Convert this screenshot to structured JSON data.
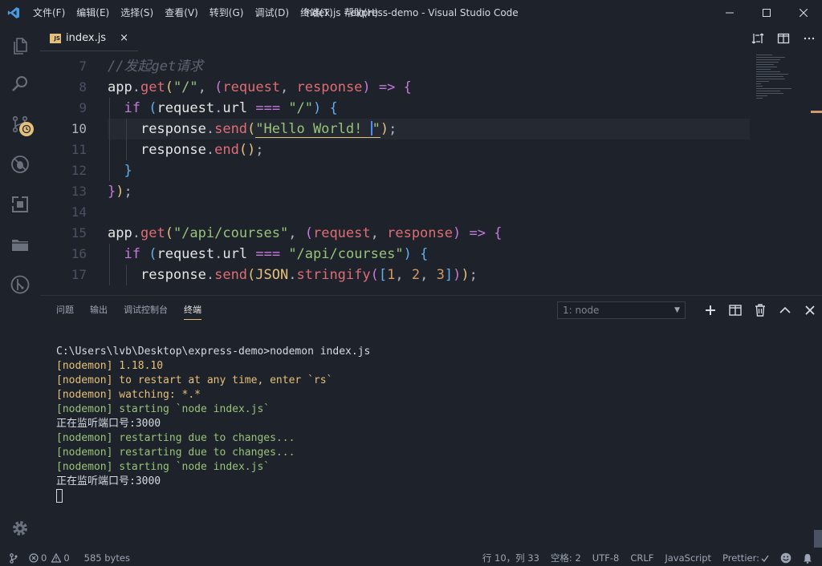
{
  "window": {
    "title": "index.js - express-demo - Visual Studio Code",
    "menu": [
      "文件(F)",
      "编辑(E)",
      "选择(S)",
      "查看(V)",
      "转到(G)",
      "调试(D)",
      "终端(T)",
      "帮助(H)"
    ]
  },
  "tab": {
    "icon_text": "JS",
    "label": "index.js",
    "close": "×"
  },
  "editor": {
    "line_numbers": [
      "7",
      "8",
      "9",
      "10",
      "11",
      "12",
      "13",
      "14",
      "15",
      "16",
      "17"
    ],
    "current_line": "10"
  },
  "panel": {
    "tabs": [
      "问题",
      "输出",
      "调试控制台",
      "终端"
    ],
    "active_tab": "终端",
    "terminal_select": "1: node",
    "terminal_lines": [
      {
        "text": "C:\\Users\\lvb\\Desktop\\express-demo>nodemon index.js",
        "color": "white"
      },
      {
        "text": "[nodemon] 1.18.10",
        "color": "yellow"
      },
      {
        "text": "[nodemon] to restart at any time, enter `rs`",
        "color": "yellow"
      },
      {
        "text": "[nodemon] watching: *.*",
        "color": "yellow"
      },
      {
        "text": "[nodemon] starting `node index.js`",
        "color": "green"
      },
      {
        "text": "正在监听端口号:3000",
        "color": "white"
      },
      {
        "text": "[nodemon] restarting due to changes...",
        "color": "green"
      },
      {
        "text": "[nodemon] restarting due to changes...",
        "color": "green"
      },
      {
        "text": "[nodemon] starting `node index.js`",
        "color": "green"
      },
      {
        "text": "正在监听端口号:3000",
        "color": "white"
      }
    ]
  },
  "statusbar": {
    "errors": "0",
    "warnings": "0",
    "file_size": "585 bytes",
    "position": "行 10，列 33",
    "spaces": "空格: 2",
    "encoding": "UTF-8",
    "eol": "CRLF",
    "language": "JavaScript",
    "prettier": "Prettier:"
  },
  "colors": {
    "background": "#1e222a",
    "accent": "#e5c07b",
    "string": "#98c379",
    "keyword": "#c678dd",
    "function": "#e06c75"
  }
}
